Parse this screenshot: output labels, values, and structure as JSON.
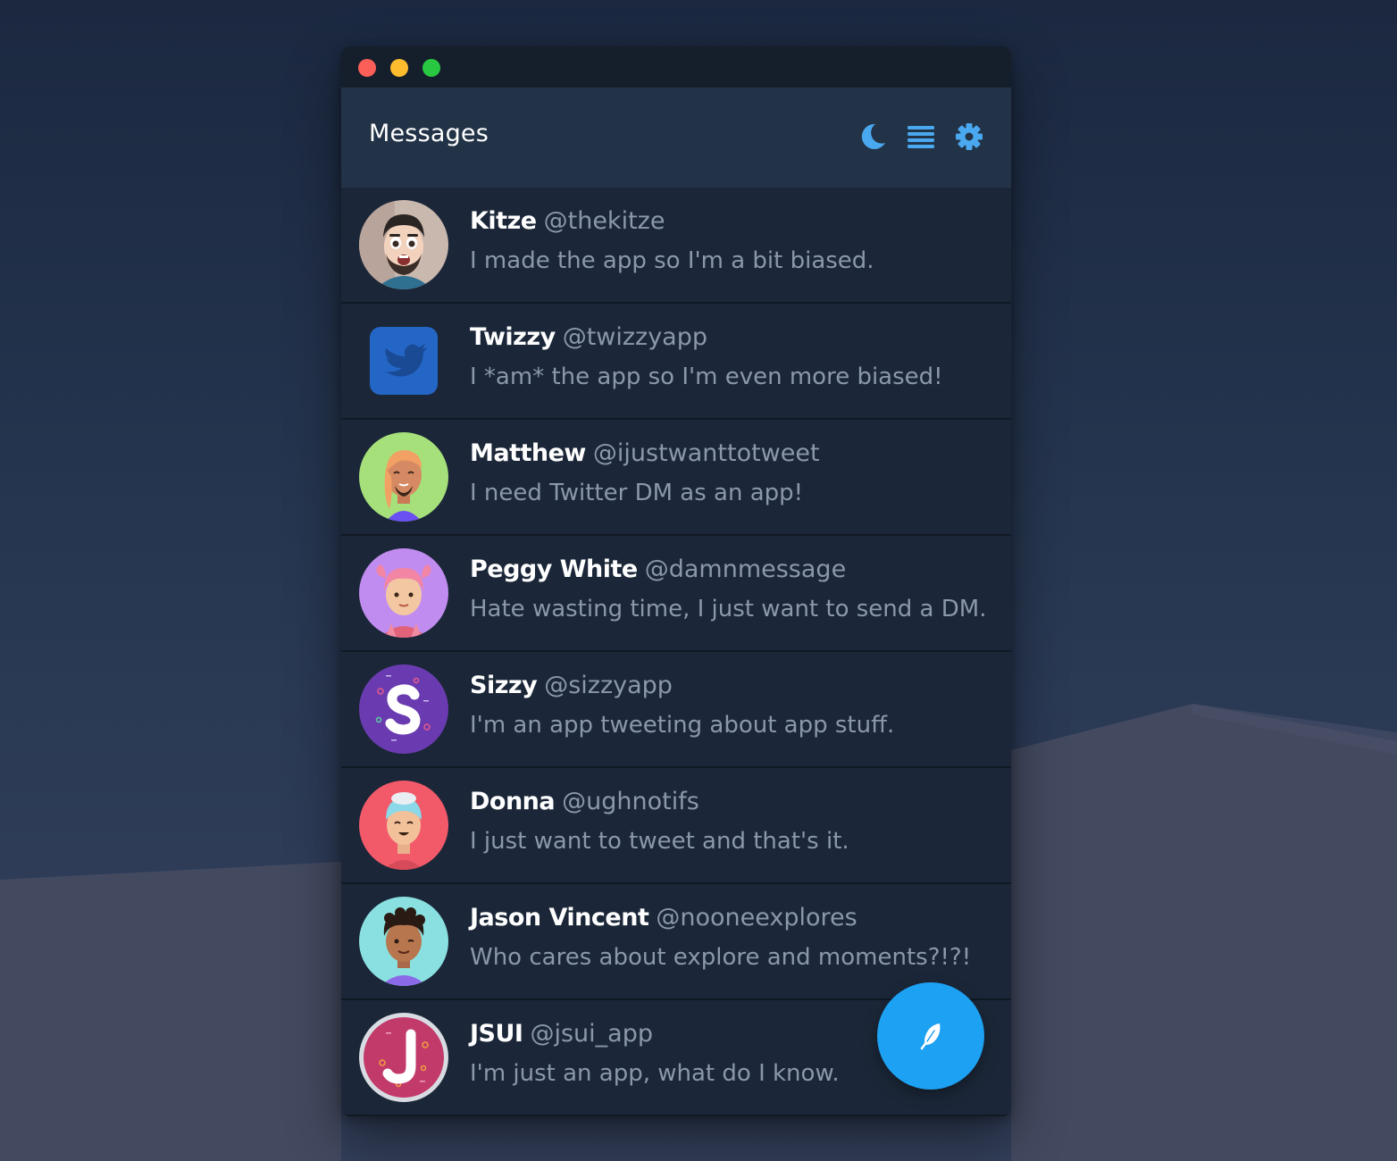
{
  "header": {
    "title": "Messages",
    "icons": [
      "moon-icon",
      "menu-icon",
      "gear-icon"
    ],
    "accent": "#4aa8f0"
  },
  "conversations": [
    {
      "name": "Kitze",
      "handle": "@thekitze",
      "message": "I made the app so I'm a bit biased.",
      "avatar": "kitze-avatar"
    },
    {
      "name": "Twizzy",
      "handle": "@twizzyapp",
      "message": "I *am* the app so I'm even more biased!",
      "avatar": "twizzy-avatar"
    },
    {
      "name": "Matthew",
      "handle": "@ijustwanttotweet",
      "message": "I need Twitter DM as an app!",
      "avatar": "matthew-avatar"
    },
    {
      "name": "Peggy White",
      "handle": "@damnmessage",
      "message": "Hate wasting time, I just want to send a DM.",
      "avatar": "peggy-avatar"
    },
    {
      "name": "Sizzy",
      "handle": "@sizzyapp",
      "message": "I'm an app tweeting about app stuff.",
      "avatar": "sizzy-avatar"
    },
    {
      "name": "Donna",
      "handle": "@ughnotifs",
      "message": "I just want to tweet and that's it.",
      "avatar": "donna-avatar"
    },
    {
      "name": "Jason Vincent",
      "handle": "@nooneexplores",
      "message": "Who cares about explore and moments?!?!",
      "avatar": "jason-avatar"
    },
    {
      "name": "JSUI",
      "handle": "@jsui_app",
      "message": "I'm just an app, what do I know.",
      "avatar": "jsui-avatar"
    }
  ],
  "compose": {
    "icon": "feather-icon",
    "color": "#1da1f2"
  }
}
